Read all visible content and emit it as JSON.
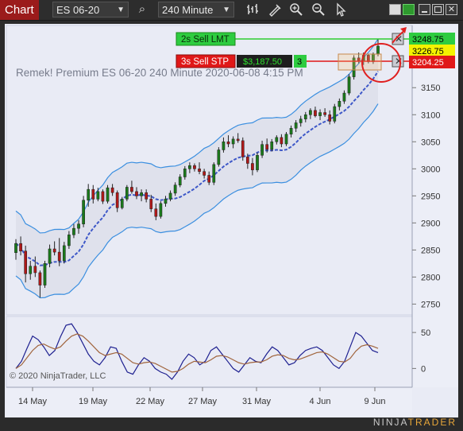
{
  "toolbar": {
    "tab_label": "Chart",
    "instrument": "ES 06-20",
    "interval": "240 Minute"
  },
  "icons": [
    "search-icon",
    "bar-type-icon",
    "draw-tool-icon",
    "zoom-in-icon",
    "zoom-out-icon",
    "pointer-icon"
  ],
  "chart_header": "Remek!  Premium  ES 06-20  240 Minute  2020-06-08 4:15 PM",
  "copyright": "© 2020 NinjaTrader, LLC",
  "brand": {
    "left": "NINJA",
    "right": "TRADER"
  },
  "orders": {
    "sell_lmt": {
      "label": "2s  Sell LMT",
      "price": "3248.75"
    },
    "sell_stp": {
      "label": "3s  Sell STP",
      "pnl": "$3,187.50",
      "qty": "3",
      "price": "3204.25"
    },
    "last_price": "3226.75"
  },
  "colors": {
    "bull": "#1b7a1b",
    "bear": "#b01818",
    "band": "#3b8fe0",
    "ma": "#3e58c8",
    "accent": "#9b1b1b"
  },
  "chart_data": [
    {
      "type": "candlestick",
      "title": "",
      "x_ticks": [
        "14 May",
        "19 May",
        "22 May",
        "27 May",
        "31 May",
        "4 Jun",
        "9 Jun"
      ],
      "y_ticks": [
        2750,
        2800,
        2850,
        2900,
        2950,
        3000,
        3050,
        3100,
        3150
      ],
      "ylim": [
        2730,
        3265
      ],
      "grid": false,
      "ohlc": [
        [
          2845,
          2870,
          2832,
          2862
        ],
        [
          2862,
          2875,
          2840,
          2848
        ],
        [
          2848,
          2858,
          2790,
          2806
        ],
        [
          2806,
          2830,
          2795,
          2820
        ],
        [
          2820,
          2838,
          2800,
          2808
        ],
        [
          2808,
          2812,
          2762,
          2785
        ],
        [
          2785,
          2830,
          2780,
          2825
        ],
        [
          2825,
          2860,
          2818,
          2852
        ],
        [
          2852,
          2866,
          2840,
          2846
        ],
        [
          2846,
          2872,
          2820,
          2830
        ],
        [
          2830,
          2865,
          2825,
          2858
        ],
        [
          2858,
          2885,
          2852,
          2878
        ],
        [
          2878,
          2898,
          2872,
          2890
        ],
        [
          2890,
          2905,
          2880,
          2898
        ],
        [
          2898,
          2950,
          2892,
          2942
        ],
        [
          2942,
          2972,
          2930,
          2962
        ],
        [
          2962,
          2970,
          2936,
          2944
        ],
        [
          2944,
          2965,
          2940,
          2958
        ],
        [
          2958,
          2962,
          2935,
          2940
        ],
        [
          2940,
          2970,
          2936,
          2965
        ],
        [
          2965,
          2972,
          2950,
          2956
        ],
        [
          2956,
          2960,
          2920,
          2928
        ],
        [
          2928,
          2948,
          2925,
          2944
        ],
        [
          2944,
          2970,
          2940,
          2966
        ],
        [
          2966,
          2978,
          2954,
          2958
        ],
        [
          2958,
          2966,
          2944,
          2950
        ],
        [
          2950,
          2962,
          2940,
          2956
        ],
        [
          2956,
          2962,
          2938,
          2944
        ],
        [
          2944,
          2952,
          2920,
          2926
        ],
        [
          2926,
          2936,
          2905,
          2912
        ],
        [
          2912,
          2940,
          2908,
          2936
        ],
        [
          2936,
          2950,
          2930,
          2944
        ],
        [
          2944,
          2960,
          2940,
          2955
        ],
        [
          2955,
          2975,
          2950,
          2970
        ],
        [
          2970,
          2990,
          2966,
          2985
        ],
        [
          2985,
          3005,
          2980,
          3000
        ],
        [
          3000,
          3012,
          2992,
          3006
        ],
        [
          3006,
          3010,
          2995,
          3000
        ],
        [
          3000,
          3012,
          2990,
          2995
        ],
        [
          2995,
          3000,
          2982,
          2988
        ],
        [
          2988,
          2995,
          2970,
          2975
        ],
        [
          2975,
          3012,
          2970,
          3008
        ],
        [
          3008,
          3040,
          3004,
          3035
        ],
        [
          3035,
          3058,
          3030,
          3050
        ],
        [
          3050,
          3062,
          3040,
          3046
        ],
        [
          3046,
          3060,
          3038,
          3055
        ],
        [
          3055,
          3066,
          3048,
          3052
        ],
        [
          3052,
          3058,
          3015,
          3022
        ],
        [
          3022,
          3028,
          3000,
          3010
        ],
        [
          3010,
          3020,
          2988,
          2998
        ],
        [
          2998,
          3030,
          2994,
          3025
        ],
        [
          3025,
          3052,
          3020,
          3045
        ],
        [
          3045,
          3056,
          3030,
          3036
        ],
        [
          3036,
          3055,
          3032,
          3050
        ],
        [
          3050,
          3062,
          3045,
          3058
        ],
        [
          3058,
          3064,
          3040,
          3046
        ],
        [
          3046,
          3068,
          3042,
          3064
        ],
        [
          3064,
          3080,
          3058,
          3075
        ],
        [
          3075,
          3090,
          3068,
          3085
        ],
        [
          3085,
          3098,
          3078,
          3092
        ],
        [
          3092,
          3105,
          3086,
          3100
        ],
        [
          3100,
          3112,
          3092,
          3108
        ],
        [
          3108,
          3115,
          3095,
          3098
        ],
        [
          3098,
          3110,
          3090,
          3104
        ],
        [
          3104,
          3112,
          3096,
          3100
        ],
        [
          3100,
          3108,
          3082,
          3088
        ],
        [
          3088,
          3120,
          3084,
          3115
        ],
        [
          3115,
          3130,
          3108,
          3125
        ],
        [
          3125,
          3145,
          3120,
          3140
        ],
        [
          3140,
          3175,
          3136,
          3170
        ],
        [
          3170,
          3210,
          3165,
          3205
        ],
        [
          3205,
          3215,
          3195,
          3200
        ],
        [
          3200,
          3215,
          3192,
          3210
        ],
        [
          3210,
          3212,
          3195,
          3198
        ],
        [
          3198,
          3215,
          3194,
          3212
        ],
        [
          3212,
          3240,
          3208,
          3226.75
        ]
      ]
    },
    {
      "type": "line",
      "title": "",
      "y_ticks": [
        0,
        50
      ],
      "series": [
        {
          "values": [
            0,
            10,
            28,
            45,
            40,
            30,
            18,
            25,
            44,
            60,
            62,
            50,
            35,
            20,
            10,
            5,
            15,
            30,
            28,
            10,
            -5,
            -8,
            5,
            15,
            10,
            0,
            -5,
            -8,
            -15,
            -5,
            10,
            20,
            15,
            5,
            10,
            25,
            30,
            20,
            10,
            0,
            -5,
            5,
            15,
            10,
            8,
            20,
            30,
            25,
            15,
            5,
            8,
            18,
            25,
            28,
            30,
            25,
            15,
            5,
            0,
            10,
            30,
            50,
            45,
            35,
            25,
            22
          ]
        },
        {
          "values": [
            0,
            5,
            15,
            25,
            32,
            34,
            30,
            27,
            30,
            38,
            45,
            48,
            45,
            38,
            30,
            22,
            18,
            20,
            22,
            20,
            14,
            8,
            6,
            8,
            9,
            7,
            3,
            -1,
            -5,
            -4,
            0,
            6,
            10,
            9,
            8,
            12,
            17,
            18,
            16,
            12,
            8,
            6,
            8,
            9,
            9,
            12,
            17,
            19,
            18,
            14,
            12,
            13,
            16,
            19,
            22,
            23,
            20,
            15,
            10,
            9,
            14,
            24,
            31,
            33,
            31,
            28
          ]
        }
      ]
    }
  ]
}
